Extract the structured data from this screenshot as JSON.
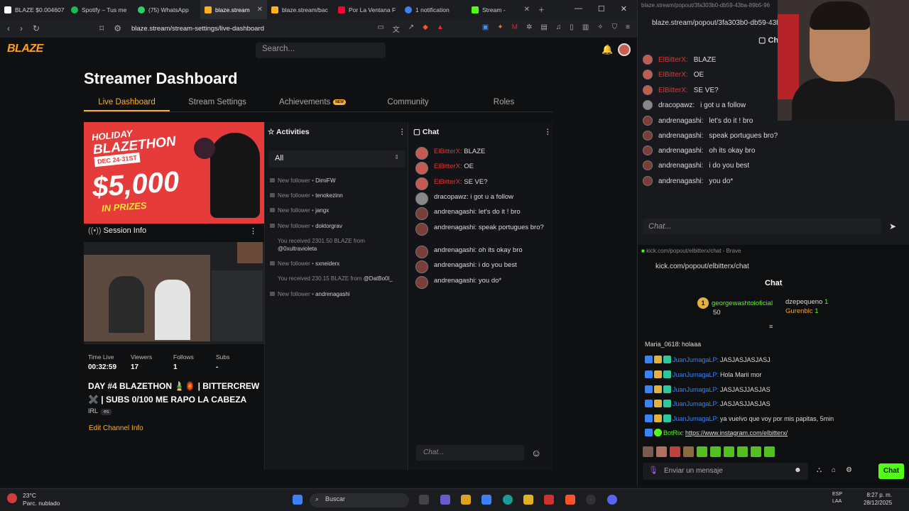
{
  "browser": {
    "tabs": [
      {
        "label": "BLAZE $0.004607",
        "color": "#ffffff"
      },
      {
        "label": "Spotify – Tus me",
        "color": "#1db954"
      },
      {
        "label": "(75) WhatsApp",
        "color": "#25d366"
      },
      {
        "label": "blaze.stream",
        "color": "#ffb020"
      },
      {
        "label": "blaze.stream/bac",
        "color": "#ffb020"
      },
      {
        "label": "Por La Ventana F",
        "color": "#ff0033"
      },
      {
        "label": "1 notification",
        "color": "#3b82f6"
      },
      {
        "label": "Stream -",
        "color": "#53fc18"
      }
    ],
    "url": "blaze.stream/stream-settings/live-dashboard"
  },
  "site": {
    "logo": "BLAZE",
    "search_placeholder": "Search...",
    "page_title": "Streamer Dashboard",
    "tabs": [
      {
        "label": "Live Dashboard"
      },
      {
        "label": "Stream Settings"
      },
      {
        "label": "Achievements",
        "badge": "NEW"
      },
      {
        "label": "Community"
      },
      {
        "label": "Roles"
      }
    ]
  },
  "promo": {
    "line1": "HOLIDAY",
    "line1b": "BLAZETHON",
    "date": "DEC 24-31ST",
    "amount": "$5,000",
    "line3": "IN PRIZES"
  },
  "session": {
    "header": "Session Info",
    "stats": [
      {
        "label": "Time Live",
        "value": "00:32:59"
      },
      {
        "label": "Viewers",
        "value": "17"
      },
      {
        "label": "Follows",
        "value": "1"
      },
      {
        "label": "Subs",
        "value": "-"
      }
    ],
    "stream_title": "DAY #4 BLAZETHON 🎍🏮 | BITTERCREW ✖️ | SUBS 0/100 ME RAPO LA CABEZA",
    "category": "IRL",
    "lang": "es",
    "edit_link": "Edit Channel Info"
  },
  "activities": {
    "header": "Activities",
    "filter": "All",
    "items": [
      {
        "text": "New follower •",
        "who": "DimiFW"
      },
      {
        "text": "New follower •",
        "who": "tenokezinn"
      },
      {
        "text": "New follower •",
        "who": "jangx"
      },
      {
        "text": "New follower •",
        "who": "doktorgrav"
      },
      {
        "text": "You received 2301.50 BLAZE from",
        "who": "@0xultravioleta"
      },
      {
        "text": "New follower •",
        "who": "sxneiderx"
      },
      {
        "text": "You received 230.15 BLAZE from",
        "who": "@DatBo0l_"
      },
      {
        "text": "New follower •",
        "who": "andrenagashi"
      }
    ]
  },
  "chat": {
    "header": "Chat",
    "placeholder": "Chat...",
    "messages": [
      {
        "user": "ElBitterX:",
        "text": "BLAZE",
        "red": true
      },
      {
        "user": "ElBitterX:",
        "text": "OE",
        "red": true
      },
      {
        "user": "ElBitterX:",
        "text": "SE VE?",
        "red": true
      },
      {
        "user": "dracopawz:",
        "text": "i got u a follow",
        "red": false
      },
      {
        "user": "andrenagashi:",
        "text": "let's do it ! bro",
        "red": false
      },
      {
        "user": "andrenagashi:",
        "text": "speak portugues bro?",
        "red": false
      },
      {
        "user": "andrenagashi:",
        "text": "oh its okay bro",
        "red": false
      },
      {
        "user": "andrenagashi:",
        "text": "i do you best",
        "red": false
      },
      {
        "user": "andrenagashi:",
        "text": "you do*",
        "red": false
      }
    ]
  },
  "popout": {
    "title": "blaze.stream/popout/3fa303b0-db59-43ba-89b5-96",
    "url": "blaze.stream/popout/3fa303b0-db59-43ba",
    "chat_label": "Chat",
    "placeholder": "Chat..."
  },
  "kick": {
    "title": "kick.com/popout/elbitterx/chat - Brave",
    "url": "kick.com/popout/elbitterx/chat",
    "chat_label": "Chat",
    "leader1": {
      "rank": "1",
      "name": "georgewashtoloficial",
      "count": "50"
    },
    "leader2": [
      {
        "name": "dzepequeno",
        "count": "1"
      },
      {
        "name": "Gurenblc",
        "count": "1"
      }
    ],
    "messages": [
      {
        "user": "Maria_0618:",
        "text": "holaaa",
        "blue": false
      },
      {
        "user": "JuanJumagaLP:",
        "text": "JASJASJASJASJ",
        "blue": true
      },
      {
        "user": "JuanJumagaLP:",
        "text": "Hola Marii mor",
        "blue": true
      },
      {
        "user": "JuanJumagaLP:",
        "text": "JASJASJJASJAS",
        "blue": true
      },
      {
        "user": "JuanJumagaLP:",
        "text": "JASJASJJASJAS",
        "blue": true
      },
      {
        "user": "JuanJumagaLP:",
        "text": "ya vuelvo que voy por mis papitas, 5min",
        "blue": true
      },
      {
        "user": "BotRix:",
        "text": "https://www.instagram.com/elbitterx/",
        "blue": false
      }
    ],
    "input_placeholder": "Enviar un mensaje",
    "send_label": "Chat"
  },
  "taskbar": {
    "weather_temp": "23°C",
    "weather_desc": "Parc. nublado",
    "search": "Buscar",
    "lang1": "ESP",
    "lang2": "LAA",
    "time": "8:27 p. m.",
    "date": "28/12/2025"
  }
}
